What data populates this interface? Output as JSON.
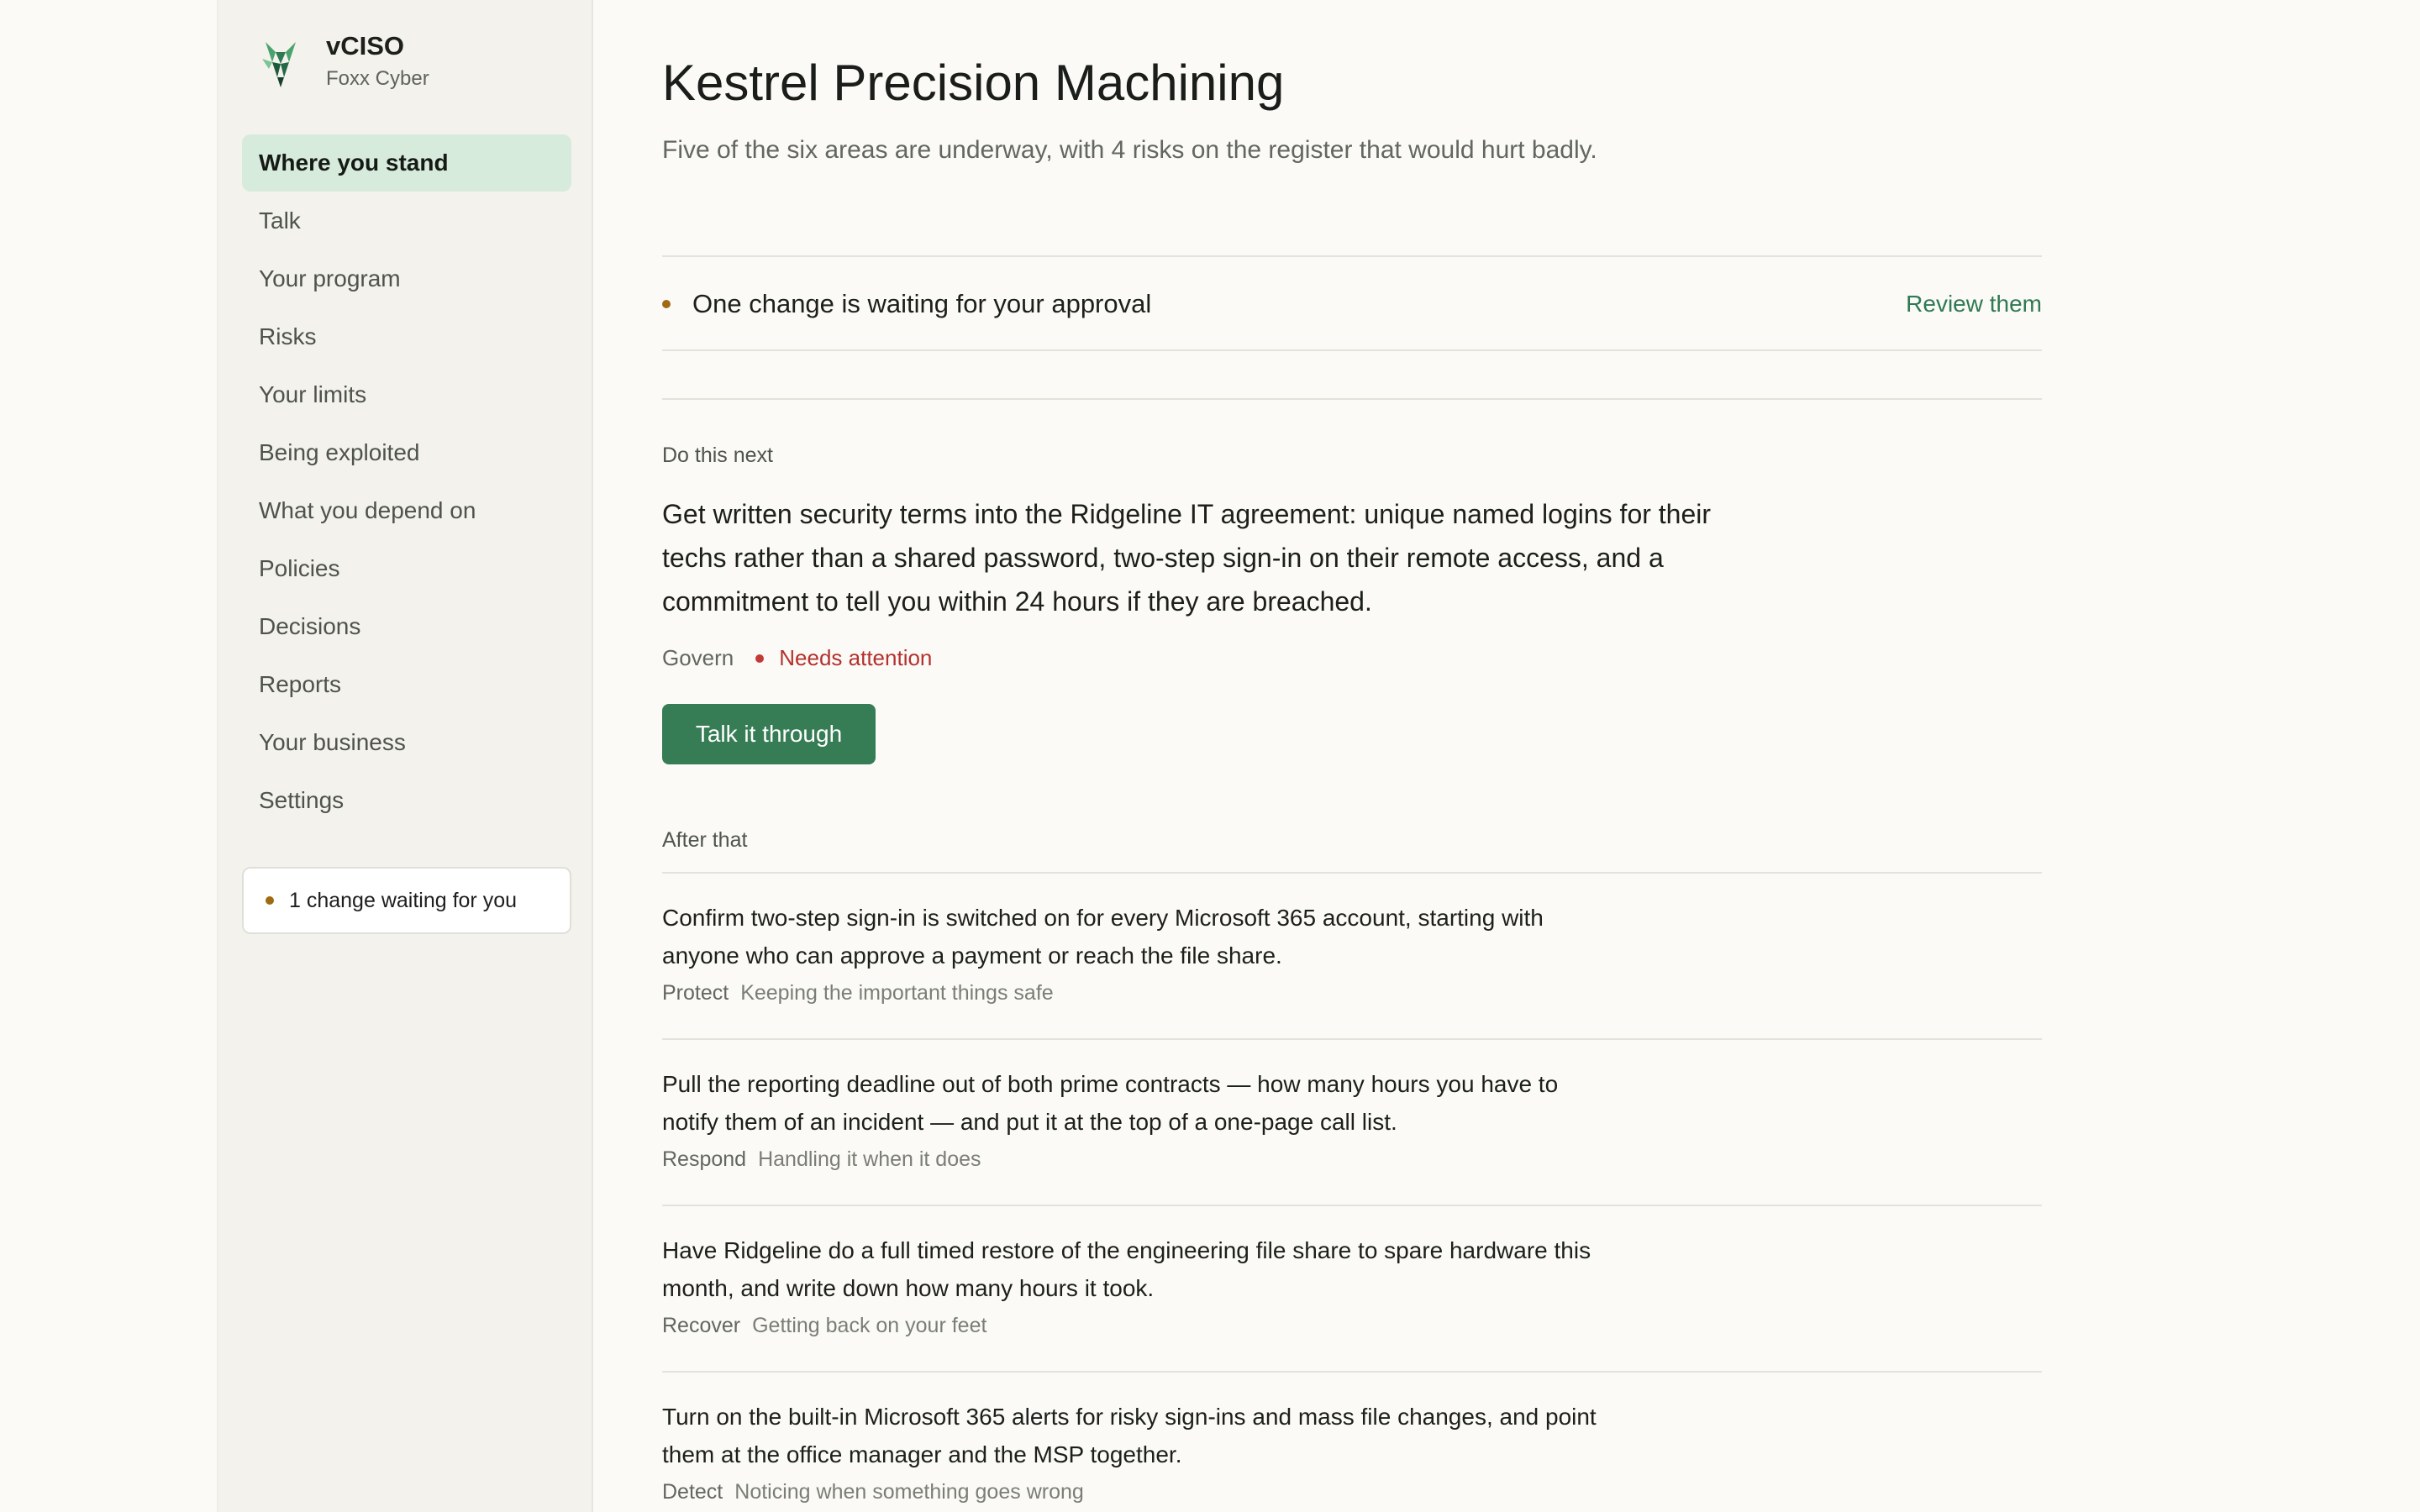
{
  "brand": {
    "name": "vCISO",
    "subtitle": "Foxx Cyber"
  },
  "sidebar": {
    "items": [
      {
        "label": "Where you stand",
        "active": true
      },
      {
        "label": "Talk"
      },
      {
        "label": "Your program"
      },
      {
        "label": "Risks"
      },
      {
        "label": "Your limits"
      },
      {
        "label": "Being exploited"
      },
      {
        "label": "What you depend on"
      },
      {
        "label": "Policies"
      },
      {
        "label": "Decisions"
      },
      {
        "label": "Reports"
      },
      {
        "label": "Your business"
      },
      {
        "label": "Settings"
      }
    ],
    "pending": "1 change waiting for you"
  },
  "main": {
    "title": "Kestrel Precision Machining",
    "summary": "Five of the six areas are underway, with 4 risks on the register that would hurt badly.",
    "approval": {
      "text": "One change is waiting for your approval",
      "link": "Review them"
    },
    "next": {
      "label": "Do this next",
      "text": "Get written security terms into the Ridgeline IT agreement: unique named logins for their techs rather than a shared password, two-step sign-in on their remote access, and a commitment to tell you within 24 hours if they are breached.",
      "area": "Govern",
      "status": "Needs attention",
      "button": "Talk it through"
    },
    "after": {
      "label": "After that",
      "items": [
        {
          "text": "Confirm two-step sign-in is switched on for every Microsoft 365 account, starting with anyone who can approve a payment or reach the file share.",
          "area": "Protect",
          "desc": "Keeping the important things safe"
        },
        {
          "text": "Pull the reporting deadline out of both prime contracts — how many hours you have to notify them of an incident — and put it at the top of a one-page call list.",
          "area": "Respond",
          "desc": "Handling it when it does"
        },
        {
          "text": "Have Ridgeline do a full timed restore of the engineering file share to spare hardware this month, and write down how many hours it took.",
          "area": "Recover",
          "desc": "Getting back on your feet"
        },
        {
          "text": "Turn on the built-in Microsoft 365 alerts for risky sign-ins and mass file changes, and point them at the office manager and the MSP together.",
          "area": "Detect",
          "desc": "Noticing when something goes wrong"
        }
      ]
    }
  },
  "colors": {
    "accent": "#367d56",
    "nav_active_bg": "#d7ebdc",
    "warning_dot": "#a06a12",
    "attention": "#b4312e"
  }
}
